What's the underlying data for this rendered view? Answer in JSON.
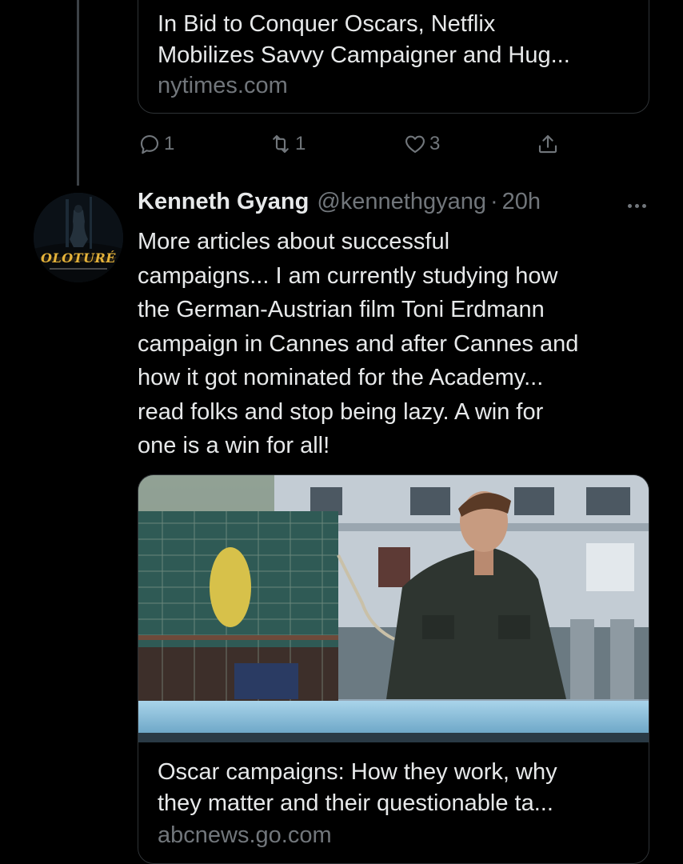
{
  "previous_tweet": {
    "card": {
      "title_line1": "In Bid to Conquer Oscars, Netflix",
      "title_line2": "Mobilizes Savvy Campaigner and Hug...",
      "domain": "nytimes.com"
    },
    "actions": {
      "reply_count": "1",
      "retweet_count": "1",
      "like_count": "3",
      "icons": [
        "reply-icon",
        "retweet-icon",
        "like-icon",
        "share-icon"
      ]
    }
  },
  "tweet": {
    "author_name": "Kenneth Gyang",
    "handle": "@kennethgyang",
    "separator": "·",
    "time": "20h",
    "avatar_label": "OLOTURÉ",
    "text_lines": [
      "More articles about successful",
      "campaigns... I am currently studying how",
      "the German-Austrian film Toni Erdmann",
      "campaign in Cannes and after Cannes and",
      "how it got nominated for the Academy...",
      "read folks and stop being lazy. A win for",
      "one is a win for all!"
    ],
    "card": {
      "title_line1": "Oscar campaigns: How they work, why",
      "title_line2": "they matter and their questionable ta...",
      "domain": "abcnews.go.com"
    }
  },
  "colors": {
    "background": "#000000",
    "text_primary": "#e7e9ea",
    "text_secondary": "#71767b",
    "border": "#2f3336"
  }
}
